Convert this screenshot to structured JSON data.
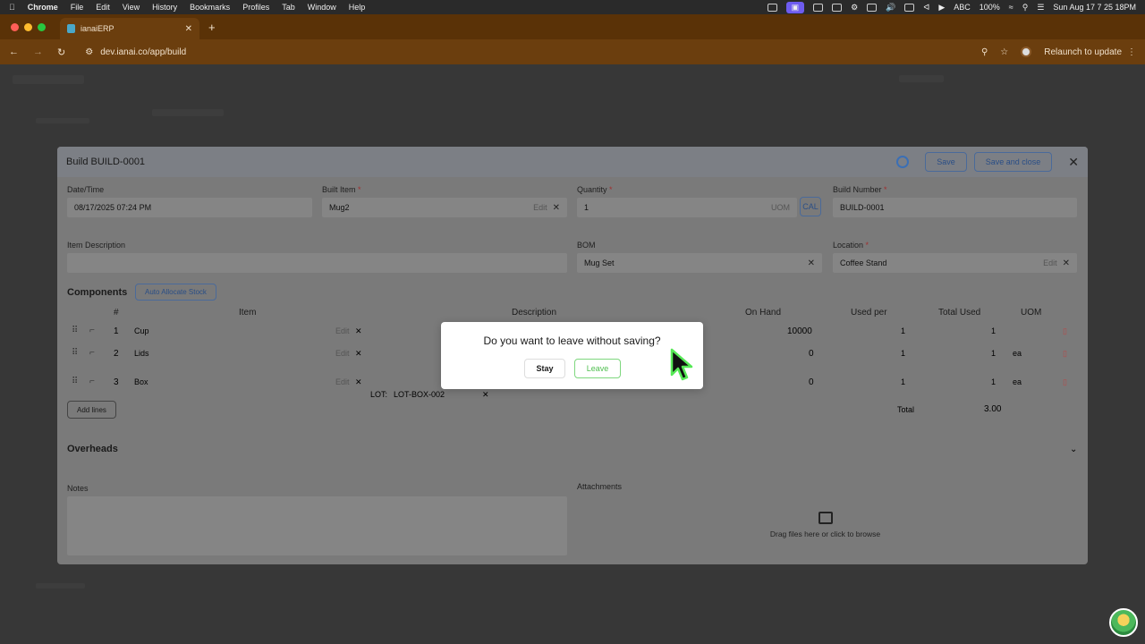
{
  "menubar": {
    "app": "Chrome",
    "items": [
      "File",
      "Edit",
      "View",
      "History",
      "Bookmarks",
      "Profiles",
      "Tab",
      "Window",
      "Help"
    ],
    "input_label": "ABC",
    "battery": "100%",
    "clock": "Sun Aug 17  7 25 18PM"
  },
  "browser": {
    "tab_title": "ianaiERP",
    "url": "dev.ianai.co/app/build",
    "relaunch": "Relaunch to update"
  },
  "modal": {
    "title": "Build BUILD-0001",
    "save": "Save",
    "save_close": "Save and close",
    "fields": {
      "datetime_label": "Date/Time",
      "datetime_value": "08/17/2025 07:24 PM",
      "built_item_label": "Built Item",
      "built_item_value": "Mug2",
      "quantity_label": "Quantity",
      "quantity_value": "1",
      "uom_hint": "UOM",
      "cal": "CAL",
      "build_number_label": "Build Number",
      "build_number_value": "BUILD-0001",
      "item_desc_label": "Item Description",
      "bom_label": "BOM",
      "bom_value": "Mug Set",
      "location_label": "Location",
      "location_value": "Coffee Stand",
      "edit": "Edit",
      "required_mark": "*",
      "clear_mark": "✕"
    },
    "components": {
      "title": "Components",
      "auto_allocate": "Auto Allocate Stock",
      "headers": [
        "#",
        "Item",
        "Description",
        "On Hand",
        "Used per",
        "Total Used",
        "UOM"
      ],
      "rows": [
        {
          "num": "1",
          "item": "Cup",
          "on_hand": "10000",
          "used_per": "1",
          "total_used": "1",
          "uom": ""
        },
        {
          "num": "2",
          "item": "Lids",
          "on_hand": "0",
          "used_per": "1",
          "total_used": "1",
          "uom": "ea"
        },
        {
          "num": "3",
          "item": "Box",
          "on_hand": "0",
          "used_per": "1",
          "total_used": "1",
          "uom": "ea"
        }
      ],
      "lot_label": "LOT:",
      "lot_value": "LOT-BOX-002",
      "add_lines": "Add lines",
      "total_label": "Total",
      "total_value": "3.00"
    },
    "overheads": "Overheads",
    "notes_label": "Notes",
    "attachments_label": "Attachments",
    "drop_text": "Drag files here or click to browse"
  },
  "dialog": {
    "question": "Do you want to leave without saving?",
    "stay": "Stay",
    "leave": "Leave"
  },
  "colors": {
    "accent": "#2a4e86",
    "leave_green": "#4fbf4f",
    "danger": "#b54a4a"
  }
}
